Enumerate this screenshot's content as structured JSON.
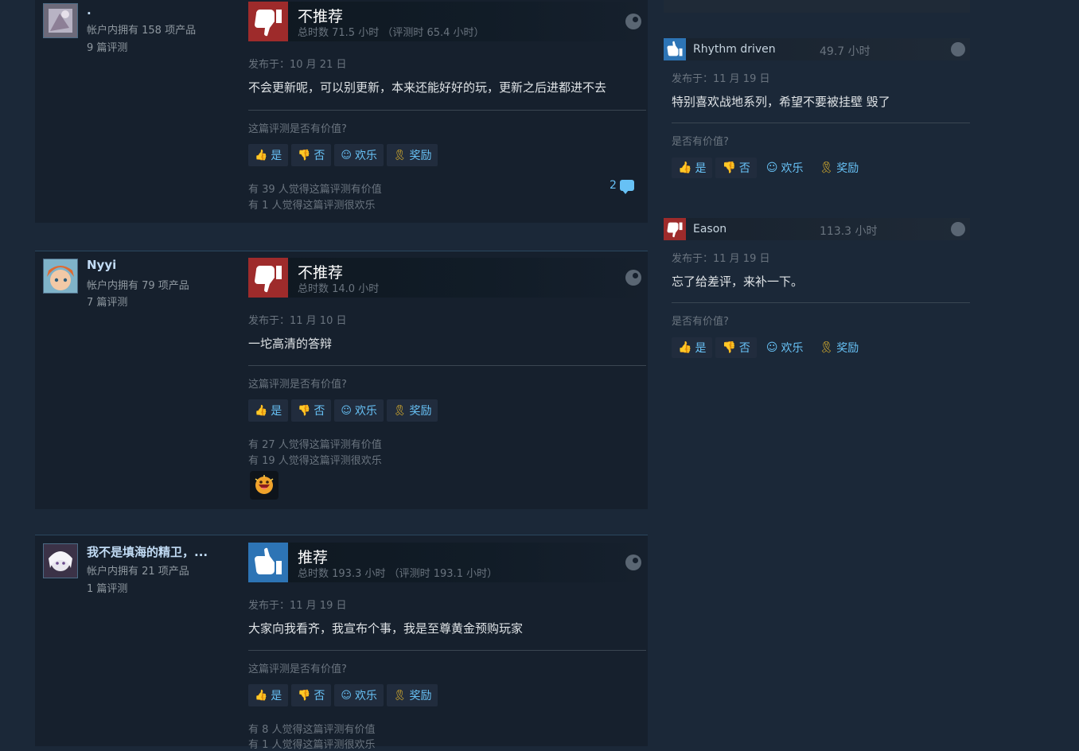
{
  "reviews": [
    {
      "username": ".",
      "products": "帐户内拥有 158 项产品",
      "review_count": "9 篇评测",
      "verdict": "不推荐",
      "hours": "总时数 71.5 小时 （评测时 65.4 小时）",
      "posted": "发布于：10 月 21 日",
      "text": "不会更新呢，可以别更新，本来还能好好的玩，更新之后进都进不去",
      "helpful_q": "这篇评测是否有价值?",
      "btn_yes": "是",
      "btn_no": "否",
      "btn_funny": "欢乐",
      "btn_award": "奖励",
      "helpful_count": "有 39 人觉得这篇评测有价值",
      "funny_count": "有 1 人觉得这篇评测很欢乐",
      "comments": "2"
    },
    {
      "username": "Nyyi",
      "products": "帐户内拥有 79 项产品",
      "review_count": "7 篇评测",
      "verdict": "不推荐",
      "hours": "总时数 14.0 小时",
      "posted": "发布于：11 月 10 日",
      "text": "一坨高清的答辩",
      "helpful_q": "这篇评测是否有价值?",
      "btn_yes": "是",
      "btn_no": "否",
      "btn_funny": "欢乐",
      "btn_award": "奖励",
      "helpful_count": "有 27 人觉得这篇评测有价值",
      "funny_count": "有 19 人觉得这篇评测很欢乐"
    },
    {
      "username": "我不是填海的精卫，...",
      "products": "帐户内拥有 21 项产品",
      "review_count": "1 篇评测",
      "verdict": "推荐",
      "hours": "总时数 193.3 小时 （评测时 193.1 小时）",
      "posted": "发布于：11 月 19 日",
      "text": "大家向我看齐，我宣布个事，我是至尊黄金预购玩家",
      "helpful_q": "这篇评测是否有价值?",
      "btn_yes": "是",
      "btn_no": "否",
      "btn_funny": "欢乐",
      "btn_award": "奖励",
      "helpful_count": "有 8 人觉得这篇评测有价值",
      "funny_count": "有 1 人觉得这篇评测很欢乐"
    }
  ],
  "side_reviews": [
    {
      "username": "Rhythm driven",
      "hours": "49.7 小时",
      "posted": "发布于：11 月 19 日",
      "text": "特别喜欢战地系列，希望不要被挂壁 毁了",
      "helpful_q": "是否有价值?",
      "btn_yes": "是",
      "btn_no": "否",
      "btn_funny": "欢乐",
      "btn_award": "奖励"
    },
    {
      "username": "Eason",
      "hours": "113.3 小时",
      "posted": "发布于：11 月 19 日",
      "text": "忘了给差评，来补一下。",
      "helpful_q": "是否有价值?",
      "btn_yes": "是",
      "btn_no": "否",
      "btn_funny": "欢乐",
      "btn_award": "奖励"
    }
  ],
  "icons": {
    "thumb_up": "thumbs-up-icon",
    "thumb_down": "thumbs-down-icon",
    "funny": "smiley-icon",
    "award": "award-icon",
    "comment": "comment-bubble-icon",
    "steam": "steam-logo-icon"
  },
  "colors": {
    "background": "#1b2838",
    "review_panel": "#16202d",
    "negative": "#9e2b2b",
    "positive": "#2d74b5",
    "link": "#67c1f5",
    "award": "#e8b92b"
  }
}
